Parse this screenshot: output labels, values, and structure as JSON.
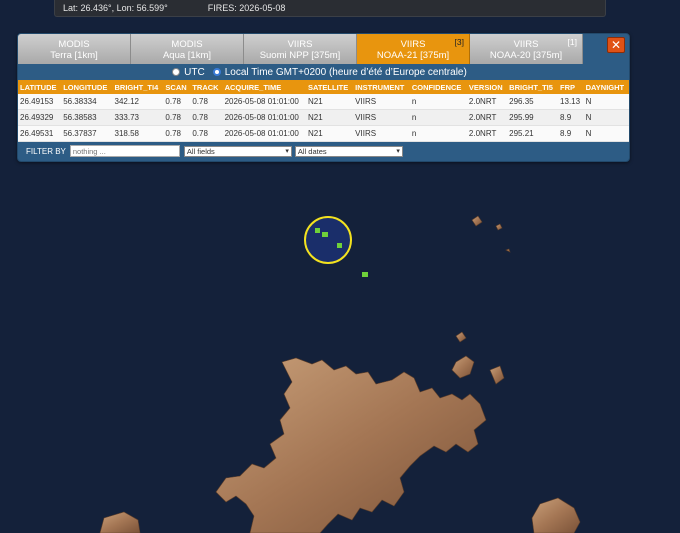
{
  "status": {
    "coords": "Lat: 26.436°, Lon: 56.599°",
    "fires": "FIRES: 2026-05-08"
  },
  "tabs": [
    {
      "l1": "MODIS",
      "l2": "Terra [1km]",
      "badge": "",
      "active": false
    },
    {
      "l1": "MODIS",
      "l2": "Aqua [1km]",
      "badge": "",
      "active": false
    },
    {
      "l1": "VIIRS",
      "l2": "Suomi NPP [375m]",
      "badge": "",
      "active": false
    },
    {
      "l1": "VIIRS",
      "l2": "NOAA-21 [375m]",
      "badge": "[3]",
      "active": true
    },
    {
      "l1": "VIIRS",
      "l2": "NOAA-20 [375m]",
      "badge": "[1]",
      "active": false
    }
  ],
  "close_label": "✕",
  "time": {
    "utc": "UTC",
    "local": "Local Time GMT+0200 (heure d’été d’Europe centrale)",
    "selected": "local"
  },
  "table": {
    "columns": [
      "LATITUDE",
      "LONGITUDE",
      "BRIGHT_TI4",
      "SCAN",
      "TRACK",
      "ACQUIRE_TIME",
      "SATELLITE",
      "INSTRUMENT",
      "CONFIDENCE",
      "VERSION",
      "BRIGHT_TI5",
      "FRP",
      "DAYNIGHT"
    ],
    "rows": [
      [
        "26.49153",
        "56.38334",
        "342.12",
        "0.78",
        "0.78",
        "2026-05-08 01:01:00",
        "N21",
        "VIIRS",
        "n",
        "2.0NRT",
        "296.35",
        "13.13",
        "N"
      ],
      [
        "26.49329",
        "56.38583",
        "333.73",
        "0.78",
        "0.78",
        "2026-05-08 01:01:00",
        "N21",
        "VIIRS",
        "n",
        "2.0NRT",
        "295.99",
        "8.9",
        "N"
      ],
      [
        "26.49531",
        "56.37837",
        "318.58",
        "0.78",
        "0.78",
        "2026-05-08 01:01:00",
        "N21",
        "VIIRS",
        "n",
        "2.0NRT",
        "295.21",
        "8.9",
        "N"
      ]
    ]
  },
  "filter": {
    "label": "FILTER BY",
    "placeholder": "nothing ...",
    "field_select": "All fields",
    "date_select": "All dates"
  },
  "colors": {
    "ocean": "#14213a",
    "accent": "#e8950e",
    "panel": "#2d5c85",
    "fire": "#6fd13a",
    "highlight_ring": "#f3e21f"
  }
}
